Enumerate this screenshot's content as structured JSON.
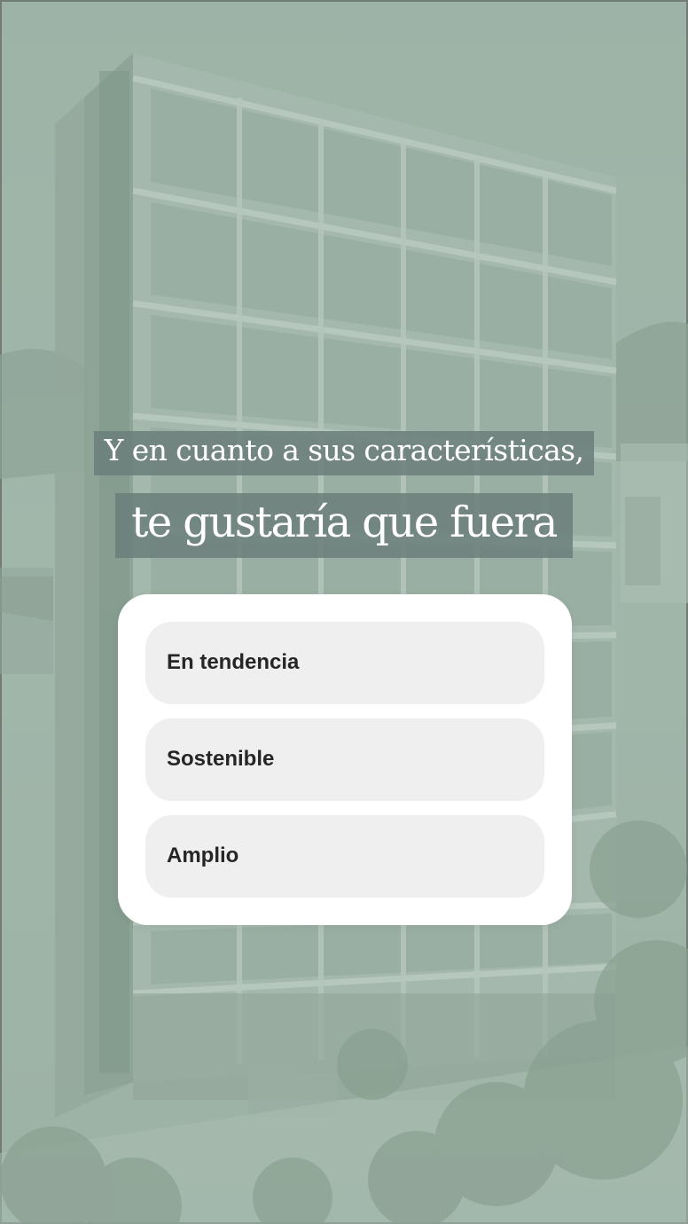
{
  "story": {
    "background_image": "building-photo",
    "caption_line_1": "Y en cuanto a sus características,",
    "caption_line_2": "te gustaría que fuera"
  },
  "poll": {
    "options": [
      {
        "label": "En tendencia"
      },
      {
        "label": "Sostenible"
      },
      {
        "label": "Amplio"
      }
    ]
  },
  "colors": {
    "overlay_tint": "#9fb5a8",
    "caption_bg": "#6c807c",
    "option_bg": "#efefef",
    "option_text": "#262626"
  }
}
